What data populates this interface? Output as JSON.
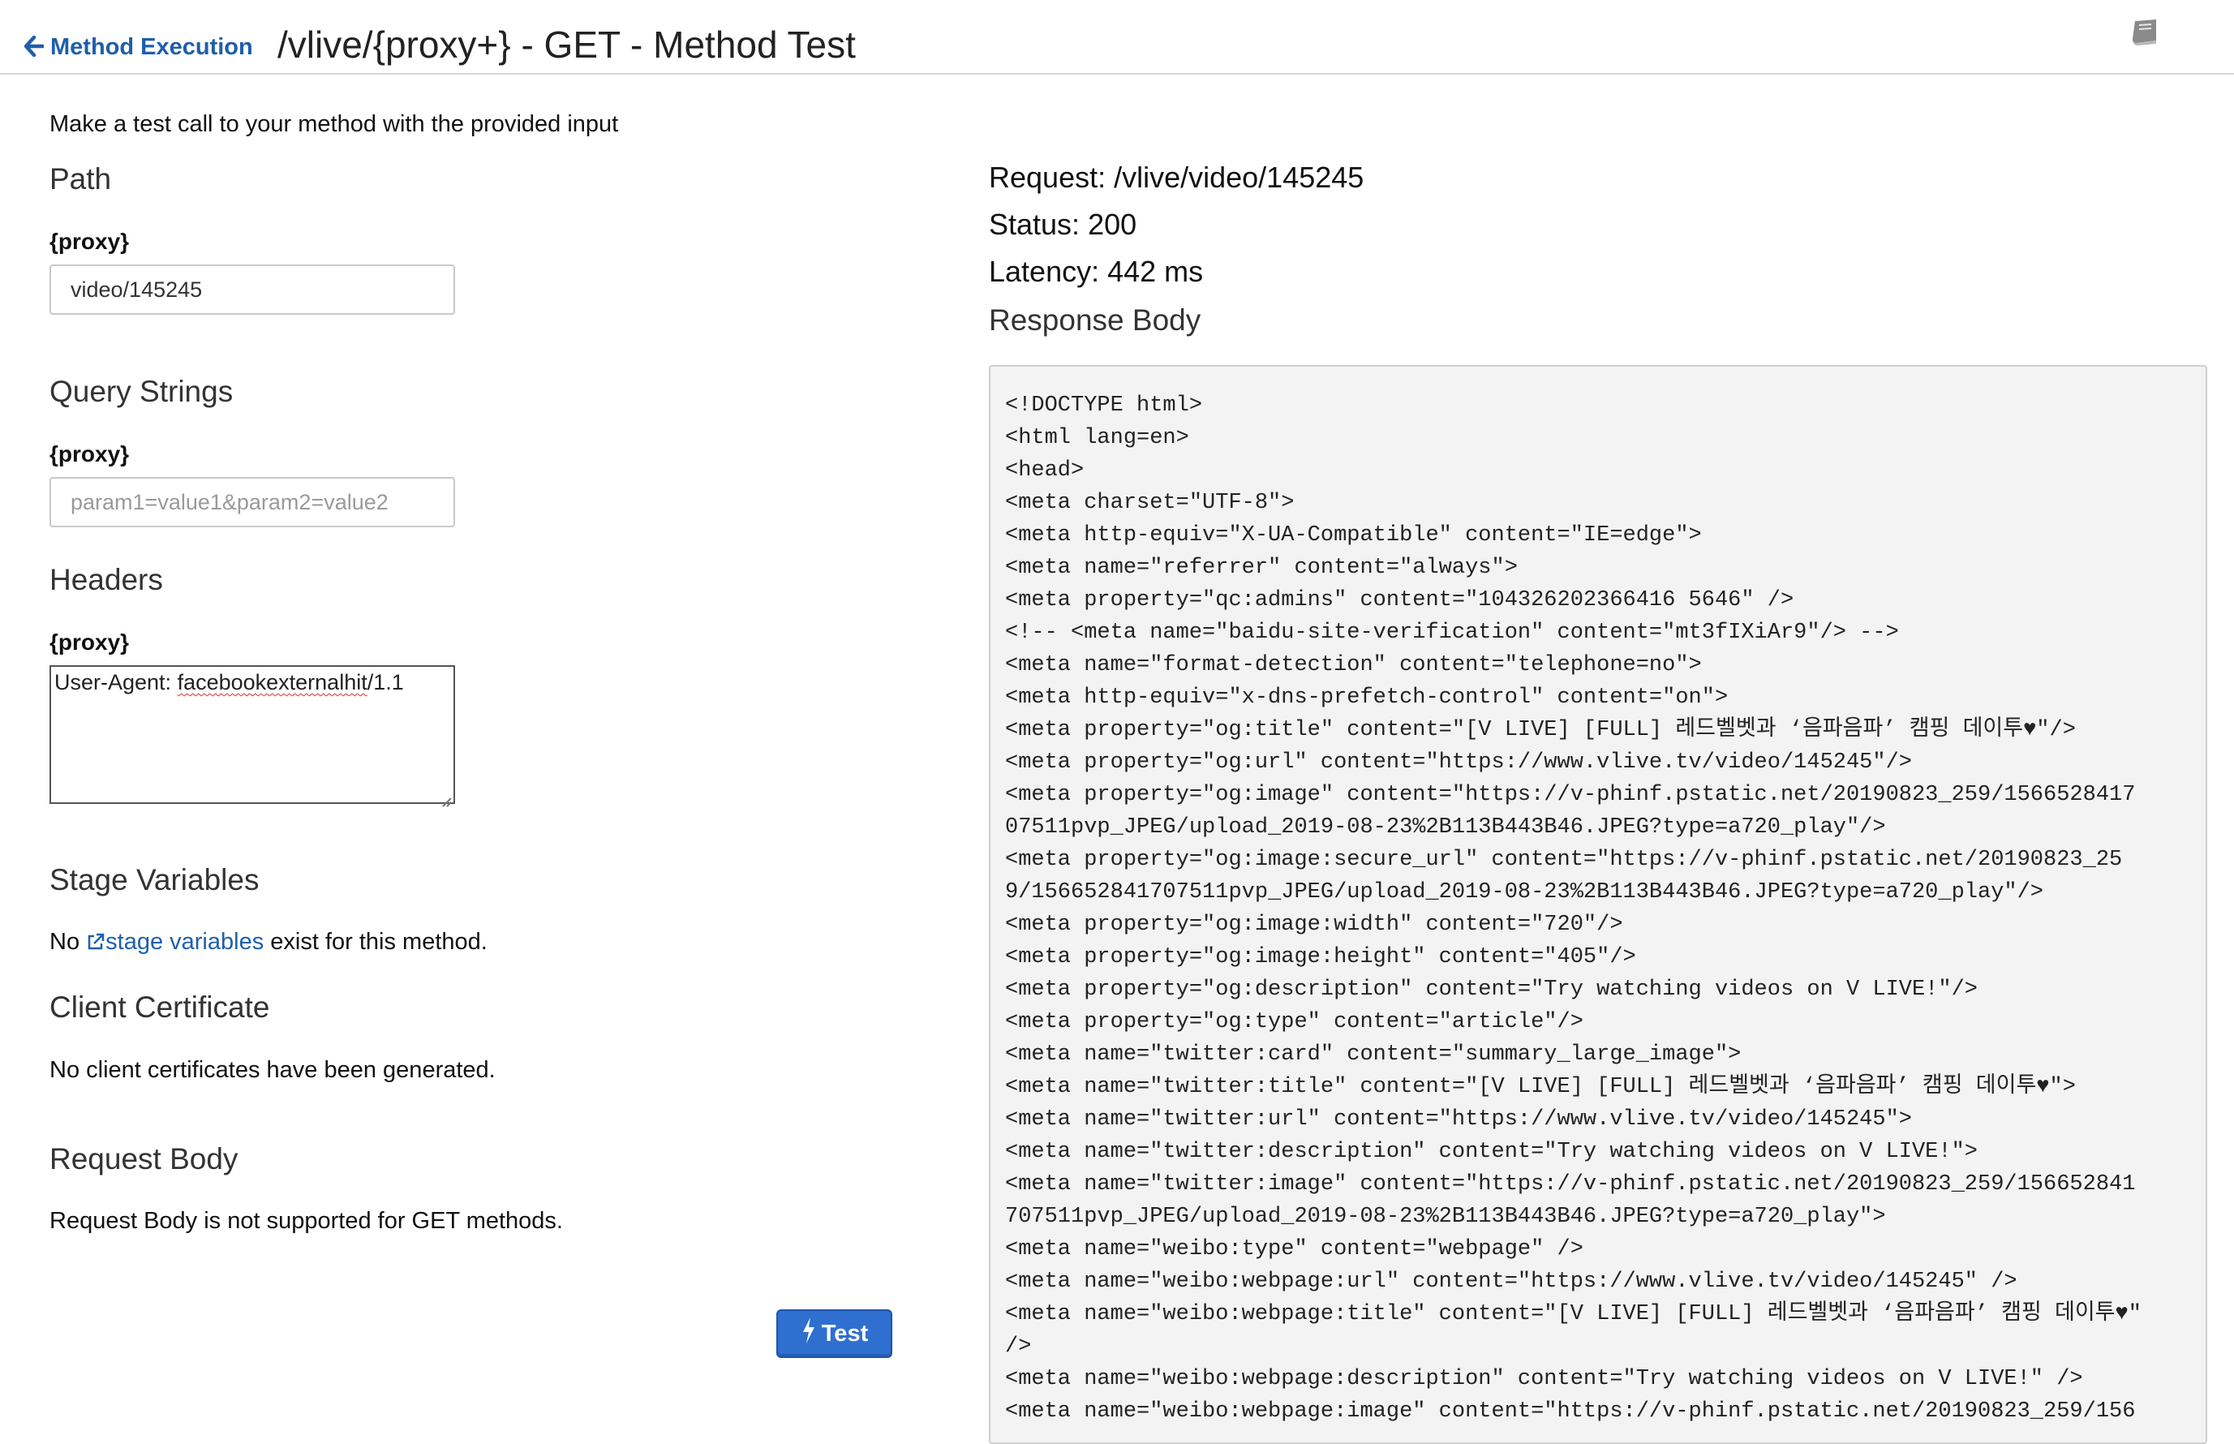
{
  "header": {
    "back_label": "Method Execution",
    "title": "/vlive/{proxy+} - GET - Method Test",
    "doc_icon": "book-icon"
  },
  "left": {
    "intro": "Make a test call to your method with the provided input",
    "path": {
      "title": "Path",
      "label": "{proxy}",
      "value": "video/145245"
    },
    "query": {
      "title": "Query Strings",
      "label": "{proxy}",
      "placeholder": "param1=value1&param2=value2"
    },
    "headers": {
      "title": "Headers",
      "label": "{proxy}",
      "value_prefix": "User-Agent: ",
      "value_misspelled": "facebookexternalhit",
      "value_suffix": "/1.1"
    },
    "stage": {
      "title": "Stage Variables",
      "text_before": "No ",
      "link": "stage variables",
      "text_after": " exist for this method."
    },
    "cert": {
      "title": "Client Certificate",
      "text": "No client certificates have been generated."
    },
    "body": {
      "title": "Request Body",
      "text": "Request Body is not supported for GET methods."
    },
    "test_button": "Test"
  },
  "right": {
    "request": "Request: /vlive/video/145245",
    "status": "Status: 200",
    "latency": "Latency: 442 ms",
    "response_title": "Response Body",
    "response_lines": [
      "<!DOCTYPE html>",
      "<html lang=en>",
      "<head>",
      "<meta charset=\"UTF-8\">",
      "<meta http-equiv=\"X-UA-Compatible\" content=\"IE=edge\">",
      "<meta name=\"referrer\" content=\"always\">",
      "<meta property=\"qc:admins\" content=\"104326202366416 5646\" />",
      "<!-- <meta name=\"baidu-site-verification\" content=\"mt3fIXiAr9\"/> -->",
      "<meta name=\"format-detection\" content=\"telephone=no\">",
      "<meta http-equiv=\"x-dns-prefetch-control\" content=\"on\">",
      "<meta property=\"og:title\" content=\"[V LIVE] [FULL] 레드벨벳과 ‘음파음파’ 캠핑 데이투♥\"/>",
      "<meta property=\"og:url\" content=\"https://www.vlive.tv/video/145245\"/>",
      "<meta property=\"og:image\" content=\"https://v-phinf.pstatic.net/20190823_259/1566528417",
      "07511pvp_JPEG/upload_2019-08-23%2B113B443B46.JPEG?type=a720_play\"/>",
      "<meta property=\"og:image:secure_url\" content=\"https://v-phinf.pstatic.net/20190823_25",
      "9/156652841707511pvp_JPEG/upload_2019-08-23%2B113B443B46.JPEG?type=a720_play\"/>",
      "<meta property=\"og:image:width\" content=\"720\"/>",
      "<meta property=\"og:image:height\" content=\"405\"/>",
      "<meta property=\"og:description\" content=\"Try watching videos on V LIVE!\"/>",
      "<meta property=\"og:type\" content=\"article\"/>",
      "<meta name=\"twitter:card\" content=\"summary_large_image\">",
      "<meta name=\"twitter:title\" content=\"[V LIVE] [FULL] 레드벨벳과 ‘음파음파’ 캠핑 데이투♥\">",
      "<meta name=\"twitter:url\" content=\"https://www.vlive.tv/video/145245\">",
      "<meta name=\"twitter:description\" content=\"Try watching videos on V LIVE!\">",
      "<meta name=\"twitter:image\" content=\"https://v-phinf.pstatic.net/20190823_259/156652841",
      "707511pvp_JPEG/upload_2019-08-23%2B113B443B46.JPEG?type=a720_play\">",
      "<meta name=\"weibo:type\" content=\"webpage\" />",
      "<meta name=\"weibo:webpage:url\" content=\"https://www.vlive.tv/video/145245\" />",
      "<meta name=\"weibo:webpage:title\" content=\"[V LIVE] [FULL] 레드벨벳과 ‘음파음파’ 캠핑 데이투♥\"",
      "/>",
      "<meta name=\"weibo:webpage:description\" content=\"Try watching videos on V LIVE!\" />",
      "<meta name=\"weibo:webpage:image\" content=\"https://v-phinf.pstatic.net/20190823_259/156"
    ]
  },
  "colors": {
    "link": "#1f5faa",
    "button": "#2f6fd0",
    "response_bg": "#f3f3f3"
  }
}
